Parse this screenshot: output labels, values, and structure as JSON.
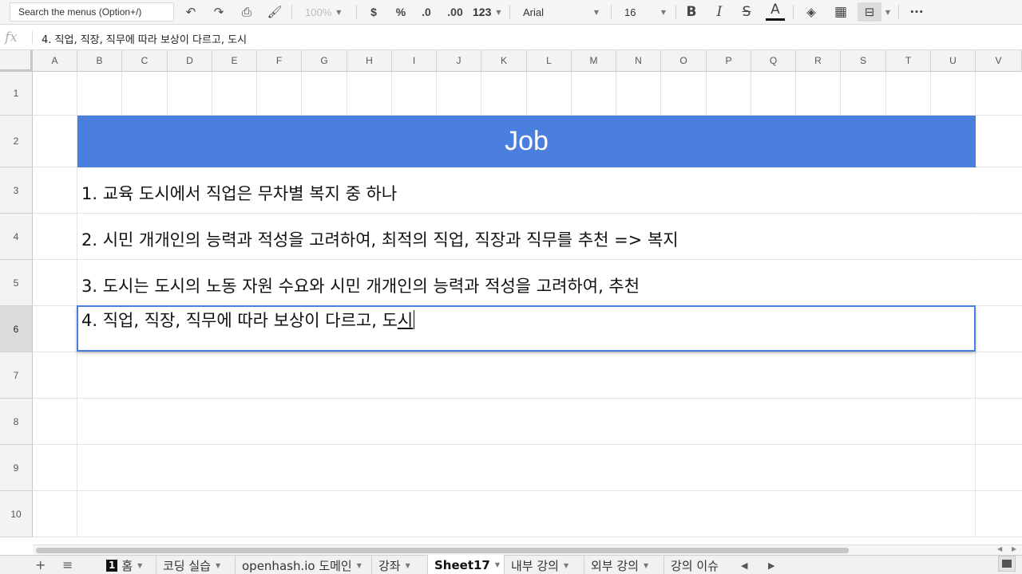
{
  "toolbar": {
    "search_placeholder": "Search the menus (Option+/)",
    "undo_icon": "undo-icon",
    "redo_icon": "redo-icon",
    "print_icon": "print-icon",
    "paint_format_icon": "paint-format-icon",
    "zoom": "100%",
    "currency": "$",
    "percent": "%",
    "decrease_decimal": ".0",
    "increase_decimal": ".00",
    "more_formats": "123",
    "font_family": "Arial",
    "font_size": "16",
    "bold": "B",
    "italic": "I",
    "strikethrough": "S",
    "text_color": "A",
    "more": "···"
  },
  "formula_bar": {
    "fx": "fx",
    "value": "4. 직업, 직장, 직무에 따라 보상이 다르고, 도시"
  },
  "columns": [
    "A",
    "B",
    "C",
    "D",
    "E",
    "F",
    "G",
    "H",
    "I",
    "J",
    "K",
    "L",
    "M",
    "N",
    "O",
    "P",
    "Q",
    "R",
    "S",
    "T",
    "U",
    "V"
  ],
  "rows": [
    "1",
    "2",
    "3",
    "4",
    "5",
    "6",
    "7",
    "8",
    "9",
    "10"
  ],
  "selected_row": "6",
  "cells": {
    "banner": "Job",
    "line1": "1. 교육 도시에서 직업은 무차별 복지 중 하나",
    "line2": "2. 시민 개개인의 능력과 적성을 고려하여, 최적의 직업, 직장과 직무를 추천 => 복지",
    "line3": "3. 도시는 도시의 노동 자원 수요와 시민 개개인의 능력과 적성을 고려하여, 추천",
    "line4_before": "4. 직업, 직장, 직무에 따라 보상이 다르고, 도",
    "line4_composing": "시"
  },
  "colors": {
    "banner_bg": "#4a7fde",
    "active_border": "#4a7fde"
  },
  "sheet_tabs": {
    "add": "+",
    "all_sheets": "≡",
    "tab1_num": "1",
    "tab1_label": "홈",
    "tab2_label": "코딩 실습",
    "tab3_label": "openhash.io 도메인",
    "tab4_label": "강좌",
    "tab5_label": "Sheet17",
    "tab6_label": "내부 강의",
    "tab7_label": "외부 강의",
    "tab8_label": "강의 이슈",
    "scroll_left": "◀",
    "scroll_right": "▶"
  }
}
